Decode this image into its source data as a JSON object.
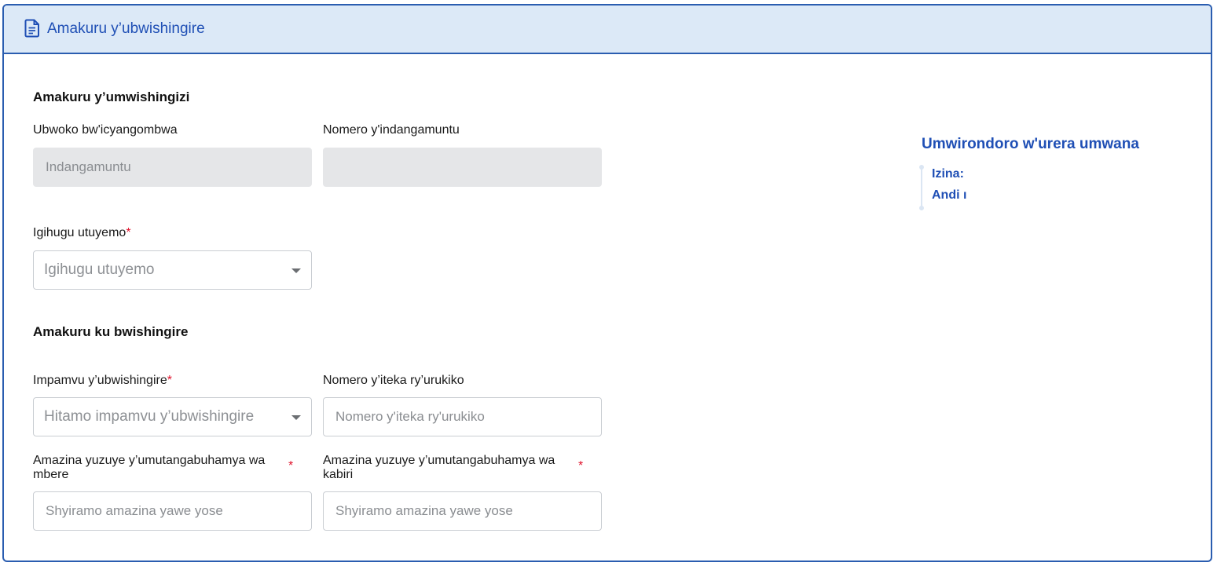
{
  "header": {
    "title": "Amakuru y’ubwishingire",
    "icon": "document-icon"
  },
  "insurer_section": {
    "title": "Amakuru y’umwishingizi",
    "id_type_label": "Ubwoko bw'icyangombwa",
    "id_type_value": "Indangamuntu",
    "id_number_label": "Nomero y'indangamuntu",
    "id_number_value": "",
    "country_label": "Igihugu utuyemo",
    "country_placeholder": "Igihugu utuyemo"
  },
  "insurance_section": {
    "title": "Amakuru ku bwishingire",
    "reason_label": "Impamvu y’ubwishingire",
    "reason_placeholder": "Hitamo impamvu y’ubwishingire",
    "case_number_label": "Nomero y’iteka ry’urukiko",
    "case_number_placeholder": "Nomero y'iteka ry'urukiko",
    "witness1_label": "Amazina yuzuye y’umutangabuhamya wa mbere",
    "witness1_placeholder": "Shyiramo amazina yawe yose",
    "witness2_label": "Amazina yuzuye y’umutangabuhamya wa kabiri",
    "witness2_placeholder": "Shyiramo amazina yawe yose"
  },
  "required_mark": "*",
  "profile_panel": {
    "title": "Umwirondoro w'urera umwana",
    "name_label": "Izina:",
    "extra_text": "Andi ı"
  },
  "colors": {
    "accent": "#1f4fb5",
    "header_bg": "#dce9f7",
    "required": "#e0102a",
    "disabled_bg": "#e5e6e8"
  }
}
